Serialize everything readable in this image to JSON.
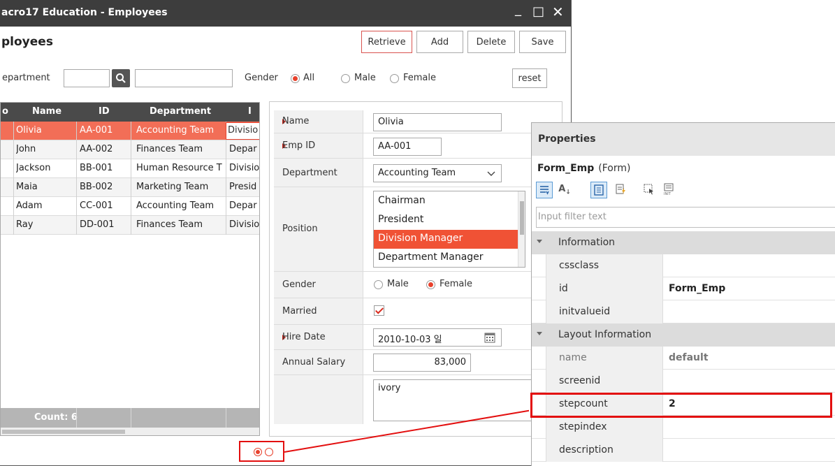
{
  "window": {
    "title": "acro17 Education - Employees",
    "min": "_",
    "max": "□",
    "close": "✕"
  },
  "screen_title": "ployees",
  "toolbar": {
    "retrieve": "Retrieve",
    "add": "Add",
    "delete": "Delete",
    "save": "Save"
  },
  "search": {
    "department_label": "epartment",
    "dept_code": "",
    "dept_name": "",
    "gender_label": "Gender",
    "gender_options": [
      "All",
      "Male",
      "Female"
    ],
    "gender_selected": "All",
    "reset": "reset"
  },
  "grid": {
    "headers": [
      "o",
      "Name",
      "ID",
      "Department",
      "I"
    ],
    "rows": [
      {
        "name": "Olivia",
        "id": "AA-001",
        "dept": "Accounting Team",
        "pos": "Divisio"
      },
      {
        "name": "John",
        "id": "AA-002",
        "dept": "Finances Team",
        "pos": "Depar"
      },
      {
        "name": "Jackson",
        "id": "BB-001",
        "dept": "Human Resource T",
        "pos": "Divisio"
      },
      {
        "name": "Maia",
        "id": "BB-002",
        "dept": "Marketing Team",
        "pos": "Presid"
      },
      {
        "name": "Adam",
        "id": "CC-001",
        "dept": "Accounting Team",
        "pos": "Depar"
      },
      {
        "name": "Ray",
        "id": "DD-001",
        "dept": "Finances Team",
        "pos": "Divisio"
      }
    ],
    "selected_row": 0,
    "footer": "Count: 6"
  },
  "form": {
    "labels": {
      "name": "Name",
      "emp_id": "Emp ID",
      "department": "Department",
      "position": "Position",
      "gender": "Gender",
      "married": "Married",
      "hire_date": "Hire Date",
      "salary": "Annual Salary"
    },
    "name": "Olivia",
    "emp_id": "AA-001",
    "department": "Accounting Team",
    "positions": [
      "Chairman",
      "President",
      "Division Manager",
      "Department Manager"
    ],
    "position_selected": "Division Manager",
    "gender_options": [
      "Male",
      "Female"
    ],
    "gender_selected": "Female",
    "married": true,
    "hire_date": "2010-10-03 일",
    "salary": "83,000",
    "memo": "ivory"
  },
  "pager": {
    "stepcount": 2,
    "stepindex": 0
  },
  "properties": {
    "title": "Properties",
    "object_name": "Form_Emp",
    "object_type": "(Form)",
    "filter_placeholder": "Input filter text",
    "tools": [
      "categorized-icon",
      "alphabetical-icon",
      "properties-icon",
      "events-icon",
      "select-object-icon",
      "init-icon"
    ],
    "categories": [
      {
        "name": "Information",
        "rows": [
          {
            "key": "cssclass",
            "value": ""
          },
          {
            "key": "id",
            "value": "Form_Emp"
          },
          {
            "key": "initvalueid",
            "value": ""
          }
        ]
      },
      {
        "name": "Layout Information",
        "rows": [
          {
            "key": "name",
            "value": "default"
          },
          {
            "key": "screenid",
            "value": ""
          },
          {
            "key": "stepcount",
            "value": "2"
          },
          {
            "key": "stepindex",
            "value": ""
          },
          {
            "key": "description",
            "value": ""
          }
        ]
      }
    ]
  },
  "colors": {
    "accent": "#e8412c",
    "selected_row": "#f26e57",
    "callout": "#e30f0f",
    "titlebar": "#3d3d3d"
  }
}
